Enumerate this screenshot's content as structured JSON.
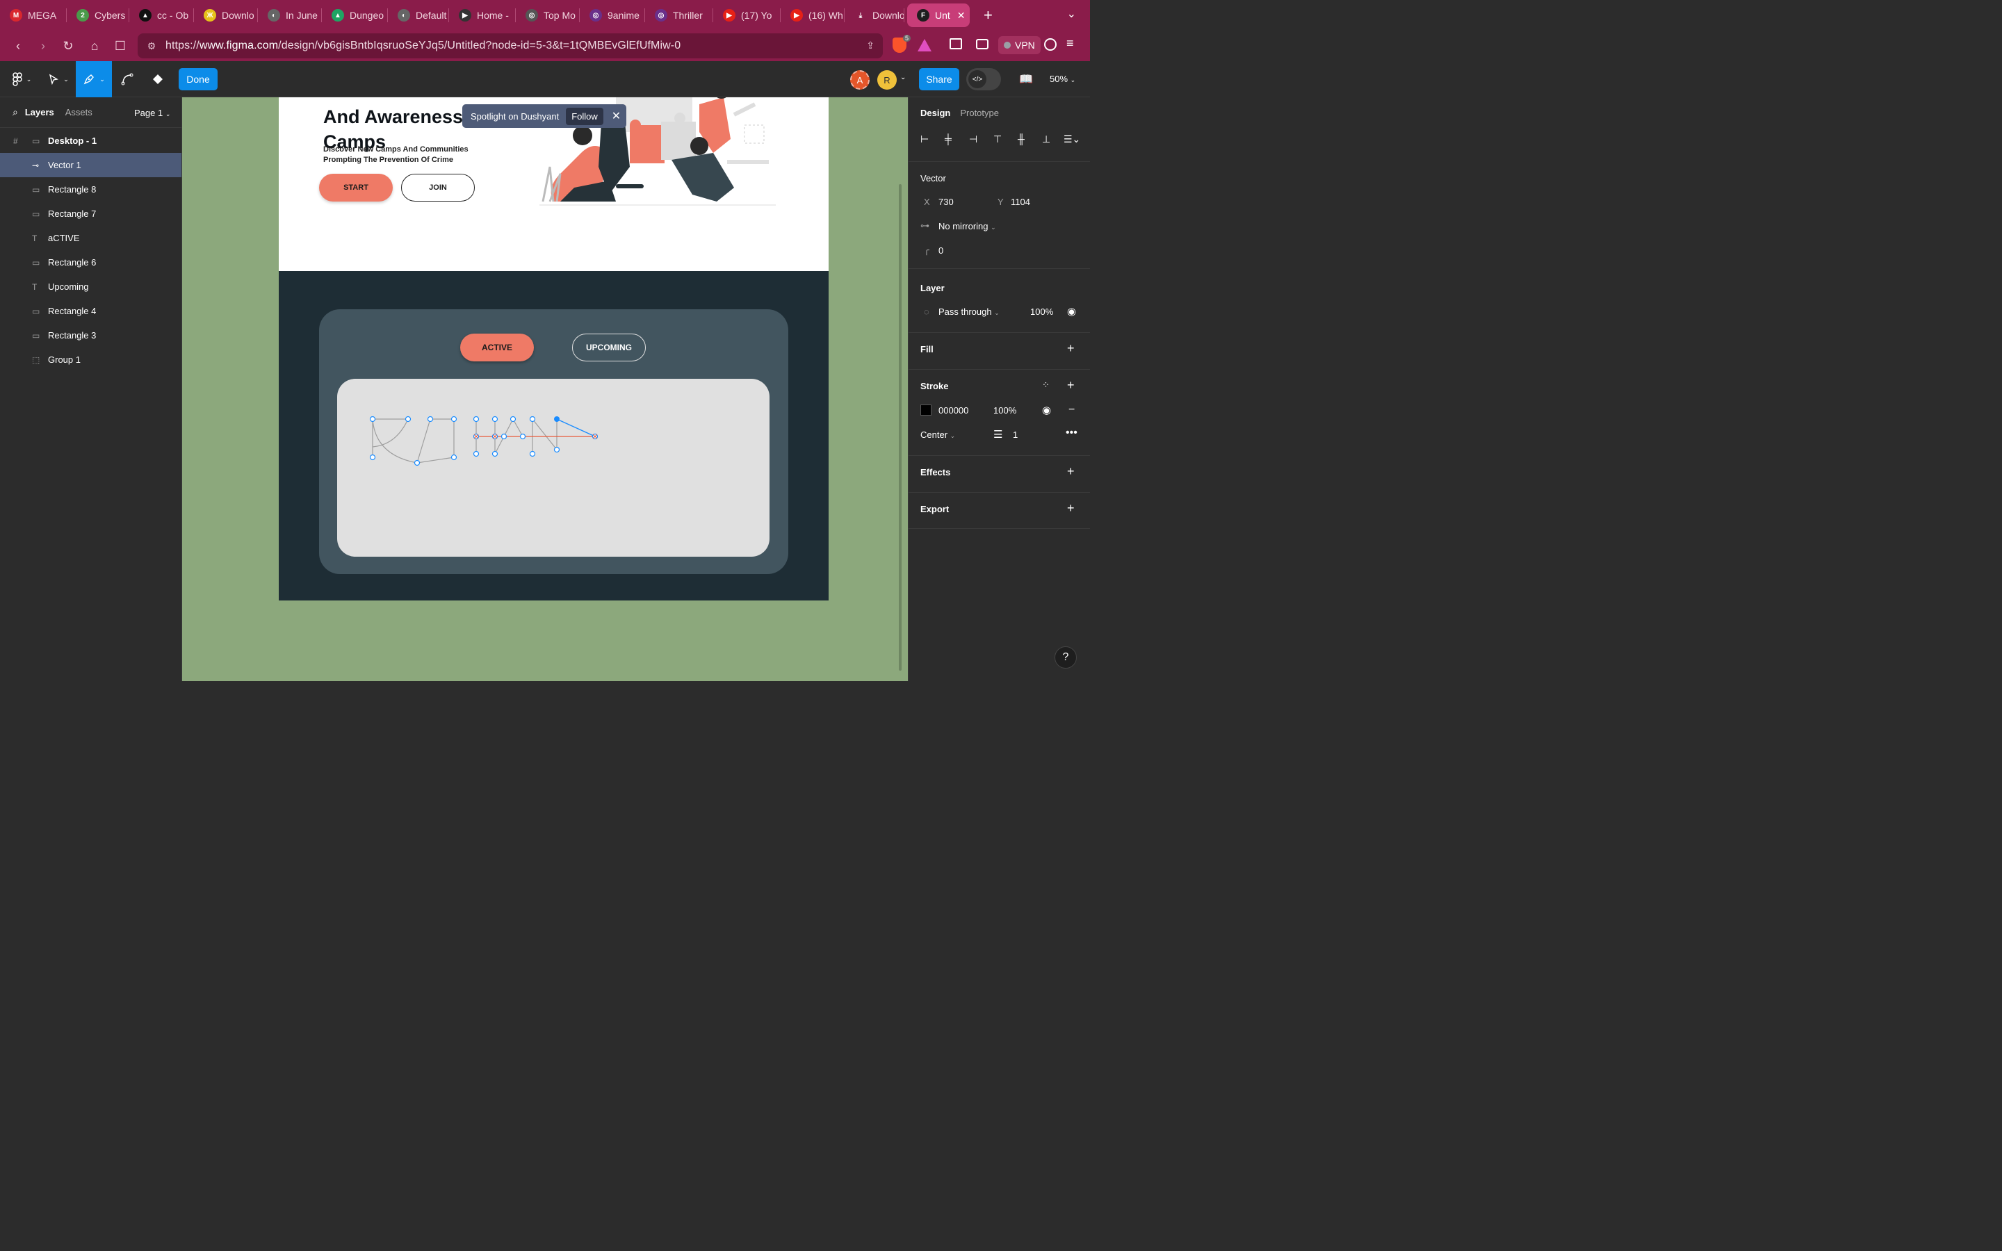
{
  "browser": {
    "tabs": [
      {
        "label": "MEGA",
        "fav_color": "#d9272e",
        "fav_text": "M"
      },
      {
        "label": "Cybers",
        "fav_color": "#4a9a4a",
        "fav_text": "2"
      },
      {
        "label": "cc - Ob",
        "fav_color": "#111",
        "fav_text": "▲"
      },
      {
        "label": "Downlo",
        "fav_color": "#e6c21a",
        "fav_text": "Ж"
      },
      {
        "label": "In June",
        "fav_color": "#666",
        "fav_text": "◐"
      },
      {
        "label": "Dungeo",
        "fav_color": "#1fa463",
        "fav_text": "▲"
      },
      {
        "label": "Default",
        "fav_color": "#666",
        "fav_text": "◐"
      },
      {
        "label": "Home -",
        "fav_color": "#333",
        "fav_text": "▶"
      },
      {
        "label": "Top Mo",
        "fav_color": "#555",
        "fav_text": "◎"
      },
      {
        "label": "9anime",
        "fav_color": "#6a2f8a",
        "fav_text": "◎"
      },
      {
        "label": "Thriller",
        "fav_color": "#6a2f8a",
        "fav_text": "◎"
      },
      {
        "label": "(17) Yo",
        "fav_color": "#e62117",
        "fav_text": "▶"
      },
      {
        "label": "(16) Wh",
        "fav_color": "#e62117",
        "fav_text": "▶"
      },
      {
        "label": "Downlo",
        "fav_color": "transparent",
        "fav_text": "⤓"
      }
    ],
    "active_tab": {
      "label": "Unt",
      "fav_color": "#1e1e1e",
      "fav_text": "F"
    },
    "new_tab": "+",
    "url_prefix": "https://",
    "url_host": "www.figma.com",
    "url_path": "/design/vb6gisBntbIqsruoSeYJq5/Untitled?node-id=5-3&t=1tQMBEvGlEfUfMiw-0",
    "brave_count": "5",
    "vpn_label": "VPN"
  },
  "toolbar": {
    "done_label": "Done",
    "share_label": "Share",
    "zoom_label": "50%",
    "avatars": [
      {
        "letter": "A",
        "color": "#e5562a"
      },
      {
        "letter": "R",
        "color": "#f0c13a"
      }
    ]
  },
  "left_panel": {
    "tab_layers": "Layers",
    "tab_assets": "Assets",
    "page_label": "Page 1",
    "frame_name": "Desktop - 1",
    "layers": [
      {
        "name": "Vector 1",
        "icon": "vector"
      },
      {
        "name": "Rectangle 8",
        "icon": "rect"
      },
      {
        "name": "Rectangle 7",
        "icon": "rect"
      },
      {
        "name": "aCTIVE",
        "icon": "text"
      },
      {
        "name": "Rectangle 6",
        "icon": "rect"
      },
      {
        "name": "Upcoming",
        "icon": "text"
      },
      {
        "name": "Rectangle 4",
        "icon": "rect"
      },
      {
        "name": "Rectangle 3",
        "icon": "rect"
      },
      {
        "name": "Group 1",
        "icon": "group"
      }
    ]
  },
  "canvas": {
    "hero_title_line1": "And Awareness",
    "hero_title_line2": "Camps",
    "hero_sub": "Discover New Camps And Communities Prompting The Prevention Of Crime",
    "start_label": "START",
    "join_label": "JOIN",
    "active_label": "ACTIVE",
    "upcoming_label": "UPCOMING",
    "spotlight_text": "Spotlight on Dushyant",
    "follow_label": "Follow",
    "colors": {
      "canvas_bg": "#8ca87c",
      "accent": "#ef7a66",
      "dark_frame": "#1e2d35",
      "card": "#42555f"
    }
  },
  "right_panel": {
    "tab_design": "Design",
    "tab_prototype": "Prototype",
    "section_vector": "Vector",
    "x_label": "X",
    "x_value": "730",
    "y_label": "Y",
    "y_value": "1104",
    "mirroring": "No mirroring",
    "corner_value": "0",
    "section_layer": "Layer",
    "blend_mode": "Pass through",
    "layer_opacity": "100%",
    "section_fill": "Fill",
    "section_stroke": "Stroke",
    "stroke_color": "000000",
    "stroke_opacity": "100%",
    "stroke_position": "Center",
    "stroke_weight": "1",
    "section_effects": "Effects",
    "section_export": "Export"
  },
  "help_label": "?"
}
